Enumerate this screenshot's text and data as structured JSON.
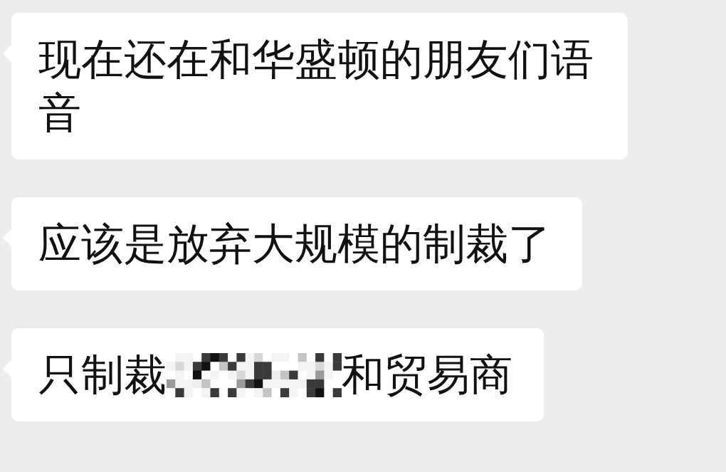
{
  "messages": [
    {
      "segments": [
        {
          "kind": "text",
          "text": "现在还在和华盛顿的朋友们语音"
        }
      ]
    },
    {
      "segments": [
        {
          "kind": "text",
          "text": "应该是放弃大规模的制裁了"
        }
      ]
    },
    {
      "segments": [
        {
          "kind": "text",
          "text": "只制裁"
        },
        {
          "kind": "redacted"
        },
        {
          "kind": "text",
          "text": "和贸易商"
        }
      ]
    }
  ]
}
